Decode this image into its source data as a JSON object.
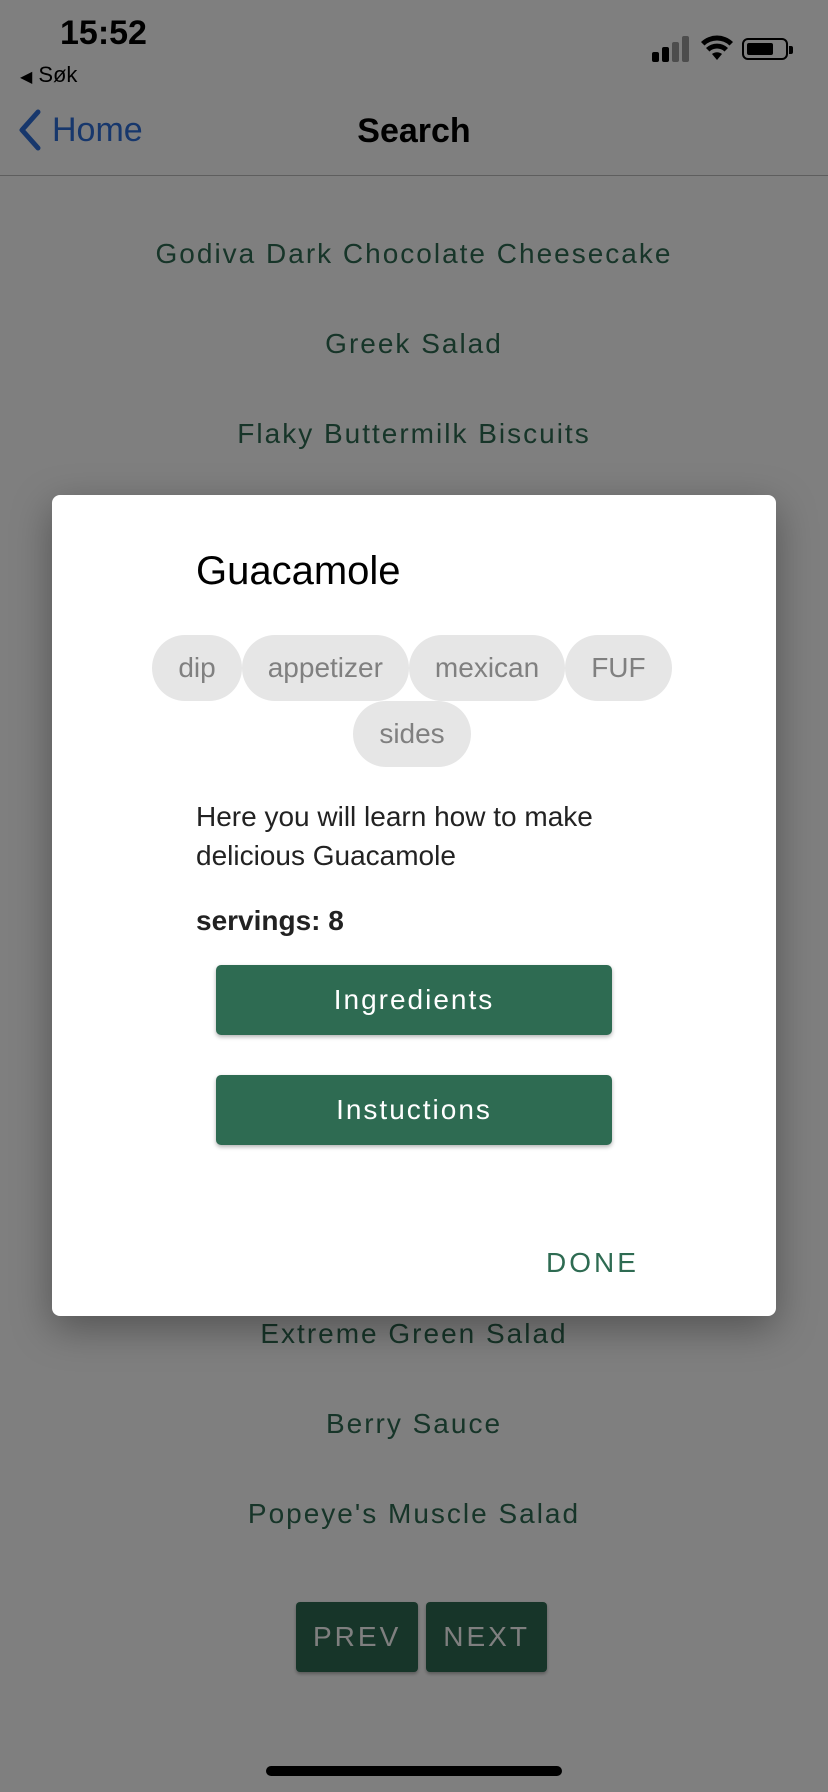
{
  "status_bar": {
    "time": "15:52",
    "back_app": "Søk"
  },
  "nav": {
    "back_label": "Home",
    "title": "Search"
  },
  "recipes": [
    "Godiva Dark Chocolate Cheesecake",
    "Greek Salad",
    "Flaky Buttermilk Biscuits",
    "Extreme Green Salad",
    "Berry Sauce",
    "Popeye's Muscle Salad"
  ],
  "pager": {
    "prev": "PREV",
    "next": "NEXT"
  },
  "dialog": {
    "title": "Guacamole",
    "tags": [
      "dip",
      "appetizer",
      "mexican",
      "FUF",
      "sides"
    ],
    "description": "Here you will learn how to make delicious Guacamole",
    "servings_label": "servings: 8",
    "ingredients_button": "Ingredients",
    "instructions_button": "Instuctions",
    "done_button": "DONE"
  },
  "colors": {
    "accent": "#2e6b52",
    "link": "#2e6fd9",
    "tag_bg": "#e6e6e6"
  }
}
